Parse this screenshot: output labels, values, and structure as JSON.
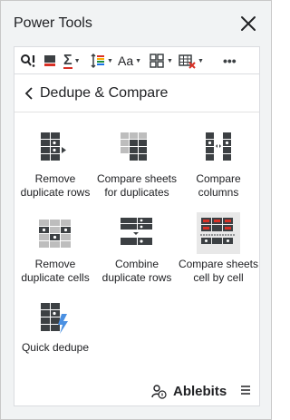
{
  "window": {
    "title": "Power Tools"
  },
  "toolbar": {
    "items": [
      {
        "icon": "find-replace-icon",
        "has_menu": false
      },
      {
        "icon": "fill-color-icon",
        "has_menu": false
      },
      {
        "icon": "sigma-icon",
        "has_menu": true
      },
      {
        "icon": "sort-icon",
        "has_menu": true
      },
      {
        "icon": "text-case-icon",
        "has_menu": true
      },
      {
        "icon": "layout-grid-icon",
        "has_menu": true
      },
      {
        "icon": "clear-table-icon",
        "has_menu": true
      },
      {
        "icon": "more-icon",
        "has_menu": false
      }
    ],
    "text_case_glyph": "Aa",
    "sigma_glyph": "Σ",
    "more_glyph": "•••"
  },
  "header": {
    "title": "Dedupe & Compare"
  },
  "tools": [
    {
      "label": "Remove\nduplicate rows",
      "icon": "remove-duplicate-rows-icon"
    },
    {
      "label": "Compare sheets\nfor duplicates",
      "icon": "compare-sheets-duplicates-icon"
    },
    {
      "label": "Compare\ncolumns",
      "icon": "compare-columns-icon"
    },
    {
      "label": "Remove\nduplicate cells",
      "icon": "remove-duplicate-cells-icon"
    },
    {
      "label": "Combine\nduplicate rows",
      "icon": "combine-duplicate-rows-icon"
    },
    {
      "label": "Compare sheets\ncell by cell",
      "icon": "compare-cell-by-cell-icon",
      "selected": true
    },
    {
      "label": "Quick dedupe",
      "icon": "quick-dedupe-icon"
    }
  ],
  "footer": {
    "brand": "Ablebits"
  },
  "colors": {
    "accent_red": "#d93025",
    "dark_cell": "#3c4043",
    "light_cell": "#bdbdbd",
    "lightning": "#4a90e2"
  }
}
